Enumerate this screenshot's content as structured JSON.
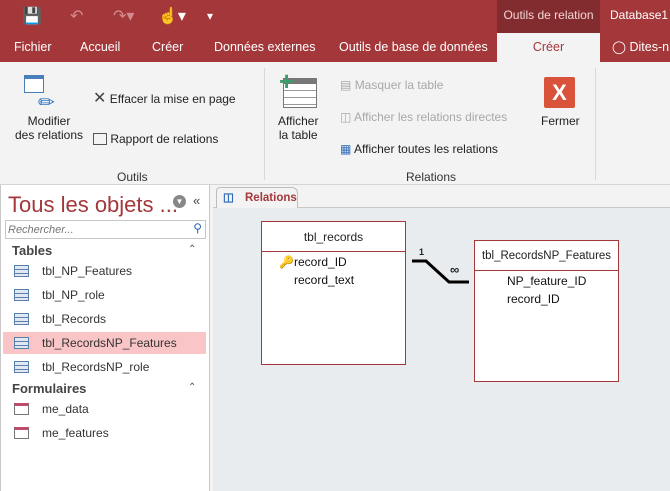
{
  "quick_access": {
    "save": "save-icon",
    "undo": "undo-icon",
    "redo": "redo-icon",
    "touch": "touch-mode-icon",
    "customize": "customize-icon"
  },
  "context_tab_group": "Outils de relation",
  "window_title": "Database1 :",
  "tabs": [
    "Fichier",
    "Accueil",
    "Créer",
    "Données externes",
    "Outils de base de données",
    "Créer"
  ],
  "tell_me": "Dites-n",
  "ribbon": {
    "outils": {
      "label": "Outils",
      "modifier": "Modifier",
      "modifier2": "des relations",
      "effacer": "Effacer la mise en page",
      "rapport": "Rapport de relations"
    },
    "relations": {
      "label": "Relations",
      "afficher": "Afficher",
      "afficher2": "la table",
      "masquer": "Masquer la table",
      "directes": "Afficher les relations directes",
      "toutes": "Afficher toutes les relations",
      "fermer": "Fermer"
    }
  },
  "nav": {
    "title": "Tous les objets ...",
    "search_placeholder": "Rechercher...",
    "sections": [
      {
        "label": "Tables",
        "items": [
          "tbl_NP_Features",
          "tbl_NP_role",
          "tbl_Records",
          "tbl_RecordsNP_Features",
          "tbl_RecordsNP_role"
        ]
      },
      {
        "label": "Formulaires",
        "items": [
          "me_data",
          "me_features"
        ]
      }
    ],
    "selected": "tbl_RecordsNP_Features"
  },
  "doc_tab": "Relations",
  "diagram": {
    "tables": [
      {
        "name": "tbl_records",
        "fields": [
          "record_ID",
          "record_text"
        ],
        "primary_key": "record_ID"
      },
      {
        "name": "tbl_RecordsNP_Features",
        "fields": [
          "NP_feature_ID",
          "record_ID"
        ]
      }
    ],
    "relationship": {
      "one": "1",
      "many": "∞"
    }
  },
  "colors": {
    "accent": "#a4373a",
    "selected": "#f9c5c7"
  }
}
